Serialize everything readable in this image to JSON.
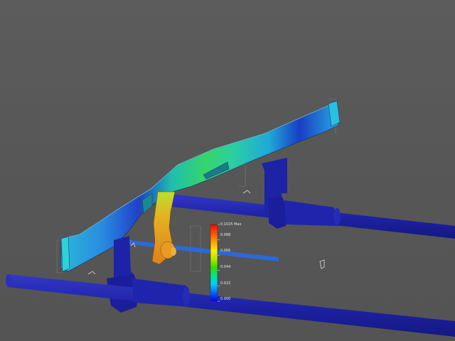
{
  "legend": {
    "colors": [
      "#0000ff",
      "#0066ff",
      "#00ccff",
      "#00e68a",
      "#33dd00",
      "#b3e600",
      "#ffea00",
      "#ffa200",
      "#ff5200",
      "#ff0000"
    ],
    "max_label": "0.1025 Max",
    "labels": [
      "0.1025 Max",
      "0.088",
      "0.066",
      "0.044",
      "0.022",
      "0.000"
    ]
  },
  "scene": {
    "background": "#575757",
    "rail_color": "#1e22a6",
    "cue_label": "⌐"
  }
}
